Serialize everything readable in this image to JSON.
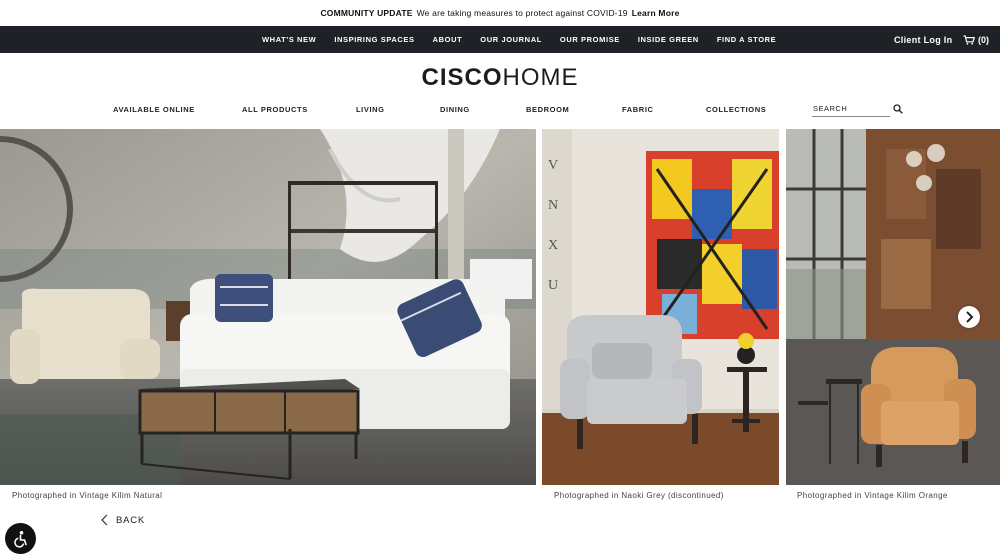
{
  "announcement": {
    "title": "COMMUNITY UPDATE",
    "text": "We are taking measures to protect against COVID-19",
    "link": "Learn More"
  },
  "topnav": {
    "links": [
      "WHAT'S NEW",
      "INSPIRING SPACES",
      "ABOUT",
      "OUR JOURNAL",
      "OUR PROMISE",
      "INSIDE GREEN",
      "FIND A STORE"
    ],
    "client_login": "Client Log In",
    "cart_count": "(0)",
    "cart_icon": "cart-icon"
  },
  "logo": {
    "bold": "CISCO",
    "light": "HOME"
  },
  "mainnav": {
    "items": [
      "AVAILABLE ONLINE",
      "ALL PRODUCTS",
      "LIVING",
      "DINING",
      "BEDROOM",
      "FABRIC",
      "COLLECTIONS"
    ],
    "search_placeholder": "SEARCH",
    "search_icon": "search-icon"
  },
  "gallery": {
    "captions": [
      "Photographed in Vintage Kilim Natural",
      "Photographed in Naoki Grey (discontinued)",
      "Photographed in Vintage Kilim Orange"
    ],
    "next_icon": "chevron-right-icon"
  },
  "back_label": "BACK",
  "accessibility_icon": "accessibility-icon",
  "colors": {
    "topnav_bg": "#1e2227",
    "text": "#222222"
  }
}
